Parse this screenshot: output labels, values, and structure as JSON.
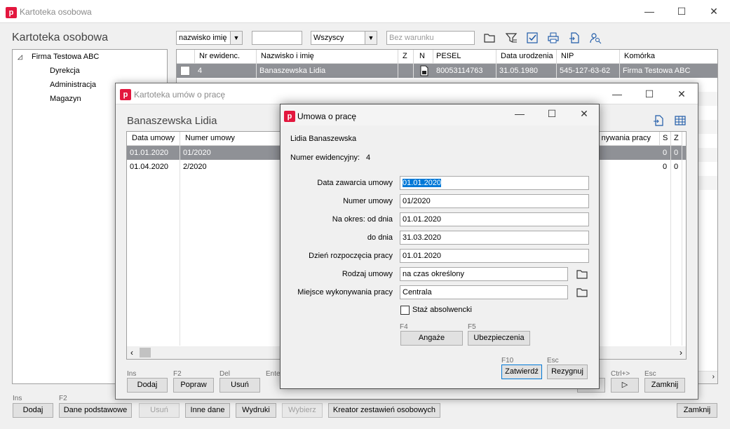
{
  "main": {
    "title": "Kartoteka osobowa",
    "heading": "Kartoteka osobowa",
    "filter_field": "nazwisko imię",
    "filter_text": "",
    "filter_scope": "Wszyscy",
    "condition_placeholder": "Bez warunku",
    "tree": {
      "root": "Firma Testowa ABC",
      "children": [
        "Dyrekcja",
        "Administracja",
        "Magazyn"
      ]
    },
    "columns": [
      "Nr ewidenc.",
      "Nazwisko i imię",
      "Z",
      "N",
      "PESEL",
      "Data urodzenia",
      "NIP",
      "Komórka"
    ],
    "rows": [
      {
        "nr": "4",
        "name": "Banaszewska Lidia",
        "z": "",
        "pesel": "80053114763",
        "dob": "31.05.1980",
        "nip": "545-127-63-62",
        "unit": "Firma Testowa ABC"
      }
    ],
    "hints": {
      "ins": "Ins",
      "f2": "F2"
    },
    "buttons": {
      "add": "Dodaj",
      "basic": "Dane podstawowe",
      "delete": "Usuń",
      "other": "Inne dane",
      "prints": "Wydruki",
      "choose": "Wybierz",
      "creator": "Kreator zestawień osobowych",
      "close": "Zamknij"
    }
  },
  "contracts": {
    "title": "Kartoteka umów o pracę",
    "person": "Banaszewska Lidia",
    "columns": [
      "Data umowy",
      "Numer umowy",
      "nywania pracy",
      "S",
      "Z"
    ],
    "rows": [
      {
        "date": "01.01.2020",
        "number": "01/2020",
        "s": "0",
        "z": "0"
      },
      {
        "date": "01.04.2020",
        "number": "2/2020",
        "s": "0",
        "z": "0"
      }
    ],
    "hints": {
      "ins": "Ins",
      "f2": "F2",
      "del": "Del",
      "enter": "Ente",
      "ctrl": "Ctrl+>",
      "esc": "Esc"
    },
    "buttons": {
      "add": "Dodaj",
      "edit": "Popraw",
      "delete": "Usuń",
      "next": "▷",
      "close": "Zamknij"
    }
  },
  "dialog": {
    "title": "Umowa o pracę",
    "employee": "Lidia Banaszewska",
    "evidence_label": "Numer ewidencyjny:",
    "evidence_value": "4",
    "fields": {
      "contract_date_label": "Data zawarcia umowy",
      "contract_date": "01.01.2020",
      "number_label": "Numer umowy",
      "number": "01/2020",
      "from_label": "Na okres:  od dnia",
      "from": "01.01.2020",
      "to_label": "do dnia",
      "to": "31.03.2020",
      "start_label": "Dzień rozpoczęcia pracy",
      "start": "01.01.2020",
      "type_label": "Rodzaj umowy",
      "type": "na czas określony",
      "place_label": "Miejsce wykonywania pracy",
      "place": "Centrala"
    },
    "graduate_label": "Staż absolwencki",
    "hints": {
      "f4": "F4",
      "f5": "F5",
      "f10": "F10",
      "esc": "Esc"
    },
    "buttons": {
      "engage": "Angaże",
      "insurance": "Ubezpieczenia",
      "confirm": "Zatwierdź",
      "cancel": "Rezygnuj"
    }
  },
  "colors": {
    "accent": "#e3173e",
    "selection": "#8f9196",
    "focus": "#0078d7"
  }
}
